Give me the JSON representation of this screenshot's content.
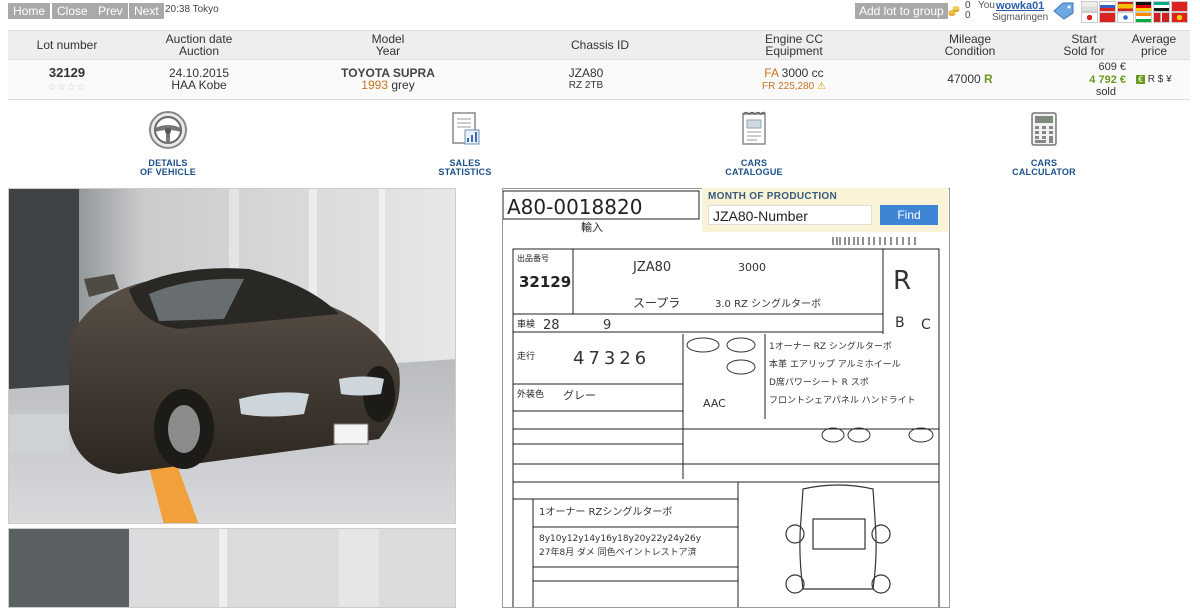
{
  "nav": {
    "home": "Home",
    "close": "Close",
    "prev": "Prev",
    "next": "Next"
  },
  "clock": "20:38 Tokyo",
  "add_group": "Add lot to group",
  "user": {
    "count_top": "0",
    "count_bottom": "0",
    "you": "You",
    "name": "wowka01",
    "city": "Sigmaringen"
  },
  "headers": {
    "lot": "Lot number",
    "auction_l1": "Auction date",
    "auction_l2": "Auction",
    "model_l1": "Model",
    "model_l2": "Year",
    "chassis": "Chassis ID",
    "engine_l1": "Engine CC",
    "engine_l2": "Equipment",
    "mileage_l1": "Mileage",
    "mileage_l2": "Condition",
    "start_l1": "Start",
    "start_l2": "Sold for",
    "avg_l1": "Average",
    "avg_l2": "price"
  },
  "lot": {
    "number": "32129",
    "date": "24.10.2015",
    "auction": "HAA Kobe",
    "model": "TOYOTA SUPRA",
    "year": "1993",
    "color": "grey",
    "chassis": "JZA80",
    "grade": "RZ 2TB",
    "fuel": "FA",
    "cc": "3000 cc",
    "equipment": "FR 225,280",
    "mileage": "47000",
    "condition": "R",
    "start": "609 €",
    "sold_for": "4 792 €",
    "status": "sold",
    "currencies": "R $ ¥"
  },
  "tools": {
    "details_l1": "DETAILS",
    "details_l2": "OF VEHICLE",
    "sales_l1": "SALES",
    "sales_l2": "STATISTICS",
    "cars_l1": "CARS",
    "cars_l2": "CATALOGUE",
    "calc_l1": "CARS",
    "calc_l2": "CALCULATOR"
  },
  "production": {
    "title": "MONTH OF PRODUCTION",
    "input_value": "JZA80-Number",
    "find": "Find"
  },
  "sheet": {
    "top_code": "A80-0018820",
    "lot": "32129",
    "chassis_code": "JZA80",
    "model_jp": "スープラ",
    "grade_jp": "3.0 RZ シングルターボ",
    "odometer": "47326",
    "color_jp": "グレー",
    "score": "R",
    "interior": "B",
    "exterior": "C",
    "notes_1": "1オーナー RZ シングルターボ",
    "notes_2": "本革 エアリップ アルミホイール",
    "notes_3": "D席パワーシート R スポ",
    "notes_4": "フロントシェアパネル ハンドライト",
    "engine": "3000",
    "color_code": "AAC"
  },
  "colors": {
    "accent": "#3f85d6",
    "sold_green": "#6a9a1f",
    "year_orange": "#c9731e",
    "title_blue": "#1b4f8a"
  }
}
